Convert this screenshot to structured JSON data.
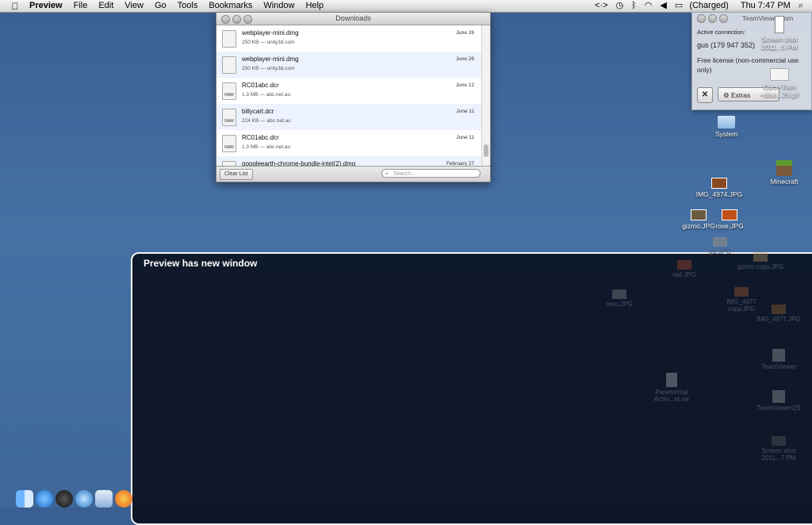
{
  "menubar": {
    "apple": "",
    "app": "Preview",
    "items": [
      "File",
      "Edit",
      "View",
      "Go",
      "Tools",
      "Bookmarks",
      "Window",
      "Help"
    ],
    "status": {
      "arrows": "<·>",
      "battery": "(Charged)",
      "clock": "Thu 7:47 PM",
      "search": "⌕"
    }
  },
  "downloads": {
    "title": "Downloads",
    "items": [
      {
        "name": "webplayer-mini.dmg",
        "meta": "250 KB — unity3d.com",
        "date": "June 26",
        "icon": "document-icon"
      },
      {
        "name": "webplayer-mini.dmg",
        "meta": "250 KB — unity3d.com",
        "date": "June 26",
        "icon": "document-icon"
      },
      {
        "name": "RC01abc.dcr",
        "meta": "1.3 MB — abc.net.au",
        "date": "June 12",
        "icon": "raw-icon"
      },
      {
        "name": "billycart.dcr",
        "meta": "224 KB — abc.net.au",
        "date": "June 11",
        "icon": "raw-icon"
      },
      {
        "name": "RC01abc.dcr",
        "meta": "1.3 MB — abc.net.au",
        "date": "June 11",
        "icon": "raw-icon"
      },
      {
        "name": "googleearth-chrome-bundle-intel(2).dmg",
        "meta": "",
        "date": "February 27",
        "icon": "document-icon"
      }
    ],
    "clear_label": "Clear List",
    "search_placeholder": "Search..."
  },
  "teamviewer": {
    "title": "TeamViewer.com",
    "active_label": "Active connection:",
    "id_text": "gus (179 947 352)",
    "license": "Free license (non-commercial use only)",
    "extras_label": "Extras",
    "close_label": "✕"
  },
  "desktop": {
    "icons": [
      {
        "label": "Screen shot 2011...5 PM"
      },
      {
        "label": "Cars+Toon +disn...29.gif"
      },
      {
        "label": "System"
      },
      {
        "label": "Minecraft"
      },
      {
        "label": "IMG_4974.JPG"
      },
      {
        "label": "gizmo.JPG"
      },
      {
        "label": "rose.JPG"
      }
    ]
  },
  "overlay": {
    "title": "Preview has new window",
    "faded_icons": [
      {
        "label": "giz.JPG"
      },
      {
        "label": "gizmo copy.JPG"
      },
      {
        "label": "red.JPG"
      },
      {
        "label": "moo.JPG"
      },
      {
        "label": "IMG_4977 copy.JPG"
      },
      {
        "label": "IMG_4977.JPG"
      },
      {
        "label": "TeamViewer"
      },
      {
        "label": "Paranormal Activi...ld.rar"
      },
      {
        "label": "TeamViewerQS"
      },
      {
        "label": "Screen shot 2011...7 PM"
      }
    ]
  },
  "dock": {
    "apps": [
      "finder",
      "app-store",
      "dashboard",
      "safari",
      "preview",
      "firefox"
    ]
  },
  "colors": {
    "desktop": "#4670a3",
    "overlay": "#060a16",
    "row_alt": "#edf3fe"
  }
}
